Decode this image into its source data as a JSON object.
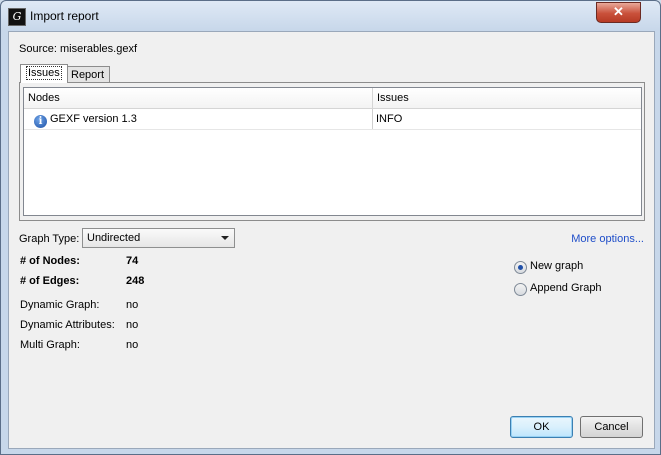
{
  "window": {
    "title": "Import report",
    "close_symbol": "✕"
  },
  "source": {
    "text": "Source: miserables.gexf"
  },
  "tabs": [
    {
      "label": "Issues"
    },
    {
      "label": "Report"
    }
  ],
  "issues_table": {
    "columns": [
      "Nodes",
      "Issues"
    ],
    "rows": [
      {
        "node": "GEXF version 1.3",
        "issue": "INFO",
        "icon": "info-icon"
      }
    ]
  },
  "graph_type": {
    "label": "Graph Type:",
    "value": "Undirected"
  },
  "more_options": "More options...",
  "stats": {
    "nodes_label": "# of Nodes:",
    "nodes_value": "74",
    "edges_label": "# of Edges:",
    "edges_value": "248",
    "dynamic_graph_label": "Dynamic Graph:",
    "dynamic_graph_value": "no",
    "dynamic_attr_label": "Dynamic Attributes:",
    "dynamic_attr_value": "no",
    "multi_graph_label": "Multi Graph:",
    "multi_graph_value": "no"
  },
  "mode": {
    "options": [
      "New graph",
      "Append Graph"
    ],
    "selected": "New graph"
  },
  "buttons": {
    "ok": "OK",
    "cancel": "Cancel"
  }
}
